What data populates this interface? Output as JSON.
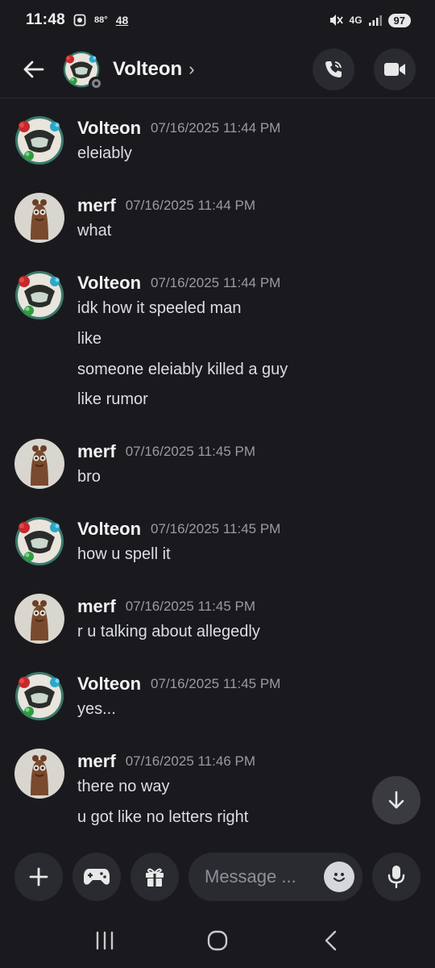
{
  "status_bar": {
    "time": "11:48",
    "temp": "88°",
    "weather": "48",
    "network": "4G",
    "battery": "97"
  },
  "header": {
    "title": "Volteon",
    "chevron": "›"
  },
  "composer": {
    "placeholder": "Message ..."
  },
  "messages": [
    {
      "author": "Volteon",
      "time": "07/16/2025 11:44 PM",
      "lines": [
        "eleiably"
      ]
    },
    {
      "author": "merf",
      "time": "07/16/2025 11:44 PM",
      "lines": [
        "what"
      ]
    },
    {
      "author": "Volteon",
      "time": "07/16/2025 11:44 PM",
      "lines": [
        "idk how it speeled man",
        "like",
        "someone eleiably killed a guy",
        "like rumor"
      ]
    },
    {
      "author": "merf",
      "time": "07/16/2025 11:45 PM",
      "lines": [
        "bro"
      ]
    },
    {
      "author": "Volteon",
      "time": "07/16/2025 11:45 PM",
      "lines": [
        "how u spell it"
      ]
    },
    {
      "author": "merf",
      "time": "07/16/2025 11:45 PM",
      "lines": [
        "r u talking about allegedly"
      ]
    },
    {
      "author": "Volteon",
      "time": "07/16/2025 11:45 PM",
      "lines": [
        "yes..."
      ]
    },
    {
      "author": "merf",
      "time": "07/16/2025 11:46 PM",
      "lines": [
        "there no way",
        "u got like no letters right"
      ]
    }
  ]
}
